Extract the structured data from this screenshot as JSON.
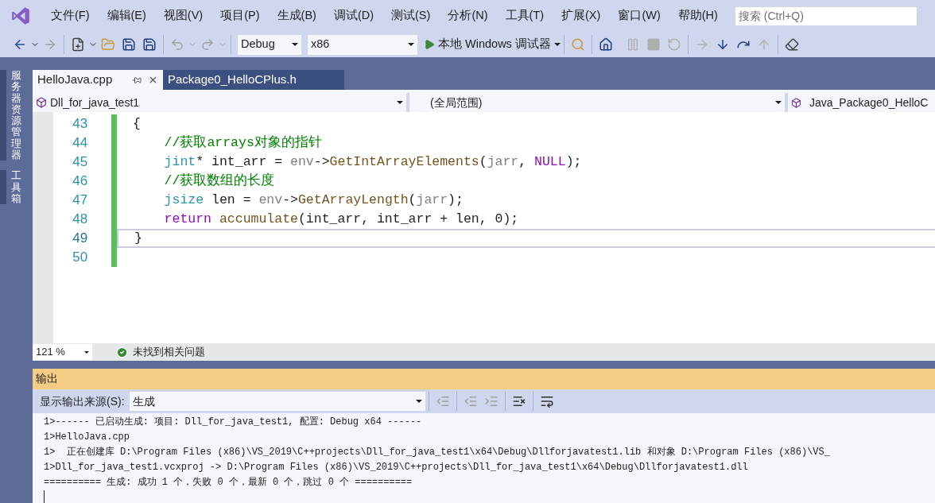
{
  "menu": [
    "文件(F)",
    "编辑(E)",
    "视图(V)",
    "项目(P)",
    "生成(B)",
    "调试(D)",
    "测试(S)",
    "分析(N)",
    "工具(T)",
    "扩展(X)",
    "窗口(W)",
    "帮助(H)"
  ],
  "search": {
    "placeholder": "搜索 (Ctrl+Q)"
  },
  "toolbar": {
    "configuration": "Debug",
    "platform": "x86",
    "debugger": "本地 Windows 调试器"
  },
  "side_tabs": [
    "服务器资源管理器",
    "工具箱"
  ],
  "tabs": [
    {
      "label": "HelloJava.cpp",
      "selected": true
    },
    {
      "label": "Package0_HelloCPlus.h",
      "selected": false
    }
  ],
  "nav": {
    "project": "Dll_for_java_test1",
    "scope": "(全局范围)",
    "member": "Java_Package0_HelloC"
  },
  "code": [
    {
      "number": "43",
      "current": false,
      "tokens": [
        {
          "kind": "plain",
          "text": "{"
        }
      ]
    },
    {
      "number": "44",
      "current": false,
      "tokens": [
        {
          "kind": "comment",
          "text": "    //获取arrays对象的指针"
        }
      ]
    },
    {
      "number": "45",
      "current": false,
      "tokens": [
        {
          "kind": "type",
          "text": "    jint"
        },
        {
          "kind": "plain",
          "text": "* int_arr = "
        },
        {
          "kind": "param",
          "text": "env"
        },
        {
          "kind": "plain",
          "text": "->"
        },
        {
          "kind": "function",
          "text": "GetIntArrayElements"
        },
        {
          "kind": "plain",
          "text": "("
        },
        {
          "kind": "param",
          "text": "jarr"
        },
        {
          "kind": "plain",
          "text": ", "
        },
        {
          "kind": "macro",
          "text": "NULL"
        },
        {
          "kind": "plain",
          "text": ");"
        }
      ]
    },
    {
      "number": "46",
      "current": false,
      "tokens": [
        {
          "kind": "comment",
          "text": "    //获取数组的长度"
        }
      ]
    },
    {
      "number": "47",
      "current": false,
      "tokens": [
        {
          "kind": "type",
          "text": "    jsize"
        },
        {
          "kind": "plain",
          "text": " len = "
        },
        {
          "kind": "param",
          "text": "env"
        },
        {
          "kind": "plain",
          "text": "->"
        },
        {
          "kind": "function",
          "text": "GetArrayLength"
        },
        {
          "kind": "plain",
          "text": "("
        },
        {
          "kind": "param",
          "text": "jarr"
        },
        {
          "kind": "plain",
          "text": ");"
        }
      ]
    },
    {
      "number": "48",
      "current": false,
      "tokens": [
        {
          "kind": "keyword",
          "text": "    return"
        },
        {
          "kind": "function",
          "text": " accumulate"
        },
        {
          "kind": "plain",
          "text": "(int_arr, int_arr + len, 0);"
        }
      ]
    },
    {
      "number": "49",
      "current": true,
      "tokens": [
        {
          "kind": "plain",
          "text": "}"
        }
      ]
    },
    {
      "number": "50",
      "current": false
    }
  ],
  "status": {
    "zoom": "121 %",
    "issues": "未找到相关问题"
  },
  "output": {
    "title": "输出",
    "source_label": "显示输出来源(S):",
    "source": "生成",
    "lines": [
      "1>------ 已启动生成: 项目: Dll_for_java_test1, 配置: Debug x64 ------",
      "1>HelloJava.cpp",
      "1>  正在创建库 D:\\Program Files (x86)\\VS_2019\\C++projects\\Dll_for_java_test1\\x64\\Debug\\Dllforjavatest1.lib 和对象 D:\\Program Files (x86)\\VS_",
      "1>Dll_for_java_test1.vcxproj -> D:\\Program Files (x86)\\VS_2019\\C++projects\\Dll_for_java_test1\\x64\\Debug\\Dllforjavatest1.dll",
      "========== 生成: 成功 1 个，失败 0 个，最新 0 个，跳过 0 个 =========="
    ]
  }
}
